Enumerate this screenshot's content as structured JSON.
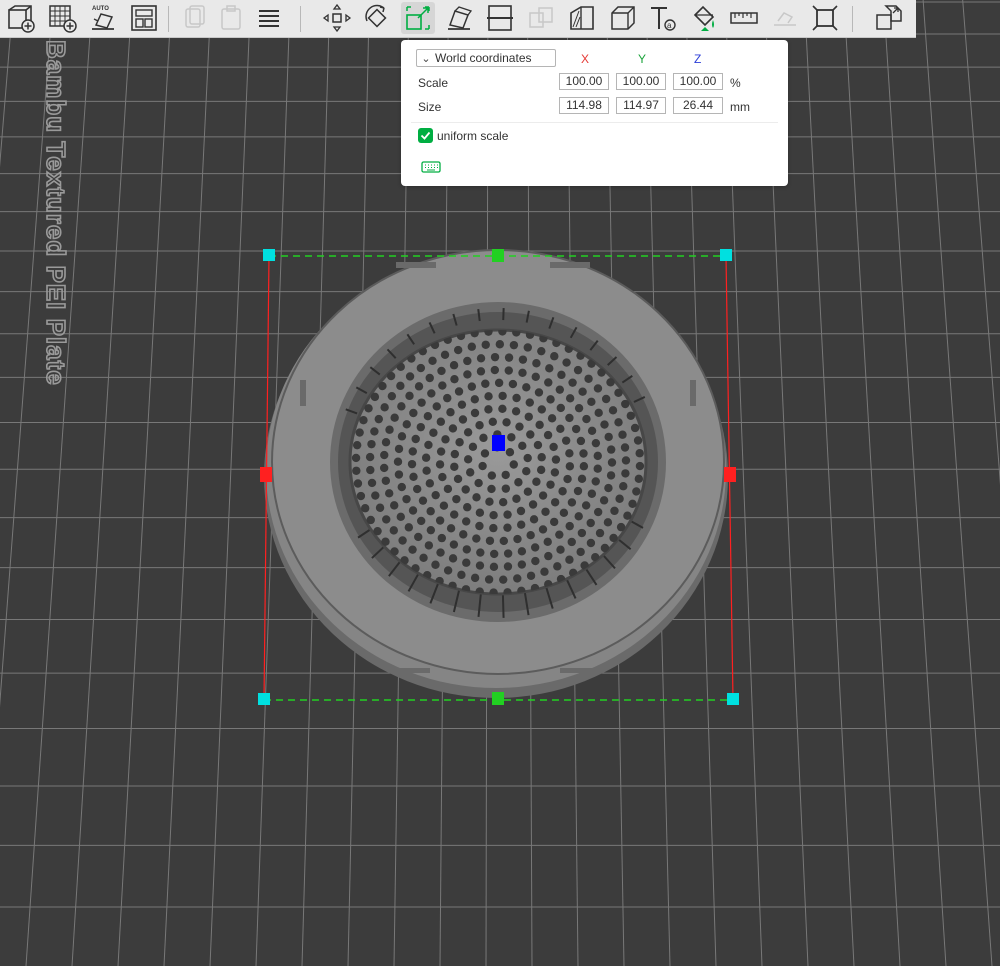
{
  "toolbar": {
    "buttons": [
      {
        "name": "add-object-button",
        "icon": "add-cube-icon"
      },
      {
        "name": "add-plate-button",
        "icon": "add-plate-grid-icon"
      },
      {
        "name": "auto-orient-button",
        "icon": "auto-orient-icon",
        "label": "AUTO"
      },
      {
        "name": "arrange-button",
        "icon": "arrange-icon"
      },
      {
        "name": "copy-button",
        "icon": "copy-icon"
      },
      {
        "name": "paste-button",
        "icon": "paste-icon"
      },
      {
        "name": "menu-button",
        "icon": "menu-lines-icon"
      },
      {
        "name": "move-button",
        "icon": "move-arrows-icon"
      },
      {
        "name": "rotate-button",
        "icon": "rotate-icon"
      },
      {
        "name": "scale-button",
        "icon": "scale-icon"
      },
      {
        "name": "lay-on-face-button",
        "icon": "lay-on-face-icon"
      },
      {
        "name": "cut-button",
        "icon": "cut-icon"
      },
      {
        "name": "split-button",
        "icon": "split-icon"
      },
      {
        "name": "support-paint-button",
        "icon": "support-paint-icon"
      },
      {
        "name": "seam-button",
        "icon": "box-icon"
      },
      {
        "name": "text-button",
        "icon": "text-icon"
      },
      {
        "name": "color-paint-button",
        "icon": "paint-bucket-icon"
      },
      {
        "name": "measure-button",
        "icon": "ruler-icon"
      },
      {
        "name": "assembly-button",
        "icon": "assembly-icon"
      },
      {
        "name": "boolean-button",
        "icon": "brim-frame-icon"
      },
      {
        "name": "explode-button",
        "icon": "puzzle-icon"
      }
    ]
  },
  "plate": {
    "label": "Bambu Textured PEI Plate"
  },
  "scale_panel": {
    "coordinate_mode": "World coordinates",
    "axes": {
      "x": "X",
      "y": "Y",
      "z": "Z"
    },
    "axis_colors": {
      "x": "#e53935",
      "y": "#1aa33a",
      "z": "#2c3ed8"
    },
    "scale": {
      "label": "Scale",
      "x": "100.00",
      "y": "100.00",
      "z": "100.00",
      "unit": "%"
    },
    "size": {
      "label": "Size",
      "x": "114.98",
      "y": "114.97",
      "z": "26.44",
      "unit": "mm"
    },
    "uniform_scale": {
      "label": "uniform scale",
      "checked": true
    },
    "keyboard_shortcut_icon": "keyboard-icon"
  },
  "colors": {
    "background": "#3c3c3c",
    "grid": "#7a7a7a",
    "accent": "#00ae42",
    "bbox_x_edges": "#ff2020",
    "bbox_y_edges": "#22d022",
    "handle_corner": "#00e0e0",
    "handle_center": "#0000ff"
  }
}
